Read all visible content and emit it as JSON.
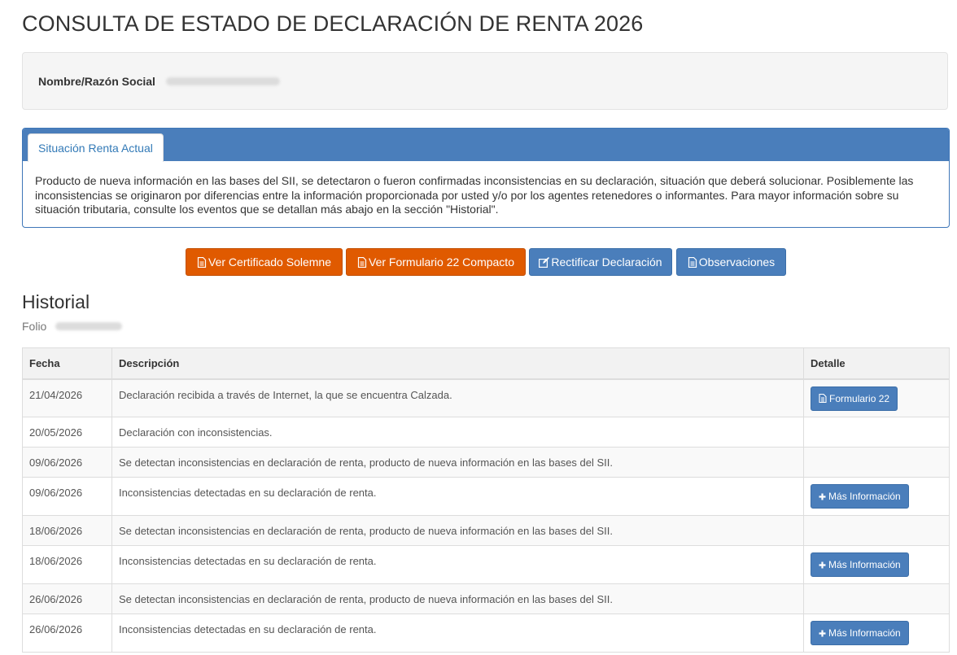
{
  "page": {
    "title": "CONSULTA DE ESTADO DE DECLARACIÓN DE RENTA 2026"
  },
  "taxpayer": {
    "name_label": "Nombre/Razón Social"
  },
  "status": {
    "tab_label": "Situación Renta Actual",
    "message": "Producto de nueva información en las bases del SII, se detectaron o fueron confirmadas inconsistencias en su declaración, situación que deberá solucionar. Posiblemente las inconsistencias se originaron por diferencias entre la información proporcionada por usted y/o por los agentes retenedores o informantes. Para mayor información sobre su situación tributaria, consulte los eventos que se detallan más abajo en la sección \"Historial\"."
  },
  "actions": [
    {
      "label": "Ver Certificado Solemne",
      "icon": "document-icon",
      "color": "#e05a00"
    },
    {
      "label": "Ver Formulario 22 Compacto",
      "icon": "document-icon",
      "color": "#e05a00"
    },
    {
      "label": "Rectificar Declaración",
      "icon": "edit-icon",
      "color": "#4a7ebb"
    },
    {
      "label": "Observaciones",
      "icon": "document-icon",
      "color": "#4a7ebb"
    }
  ],
  "history": {
    "title": "Historial",
    "folio_label": "Folio",
    "columns": [
      "Fecha",
      "Descripción",
      "Detalle"
    ],
    "rows": [
      {
        "date": "21/04/2026",
        "description": "Declaración recibida a través de Internet, la que se encuentra Calzada.",
        "action": "Formulario 22",
        "action_icon": "document-icon"
      },
      {
        "date": "20/05/2026",
        "description": "Declaración con inconsistencias.",
        "action": null
      },
      {
        "date": "09/06/2026",
        "description": "Se detectan inconsistencias en declaración de renta, producto de nueva información en las bases del SII.",
        "action": null
      },
      {
        "date": "09/06/2026",
        "description": "Inconsistencias detectadas en su declaración de renta.",
        "action": "Más Información",
        "action_icon": "plus-icon"
      },
      {
        "date": "18/06/2026",
        "description": "Se detectan inconsistencias en declaración de renta, producto de nueva información en las bases del SII.",
        "action": null
      },
      {
        "date": "18/06/2026",
        "description": "Inconsistencias detectadas en su declaración de renta.",
        "action": "Más Información",
        "action_icon": "plus-icon"
      },
      {
        "date": "26/06/2026",
        "description": "Se detectan inconsistencias en declaración de renta, producto de nueva información en las bases del SII.",
        "action": null
      },
      {
        "date": "26/06/2026",
        "description": "Inconsistencias detectadas en su declaración de renta.",
        "action": "Más Información",
        "action_icon": "plus-icon"
      }
    ]
  }
}
